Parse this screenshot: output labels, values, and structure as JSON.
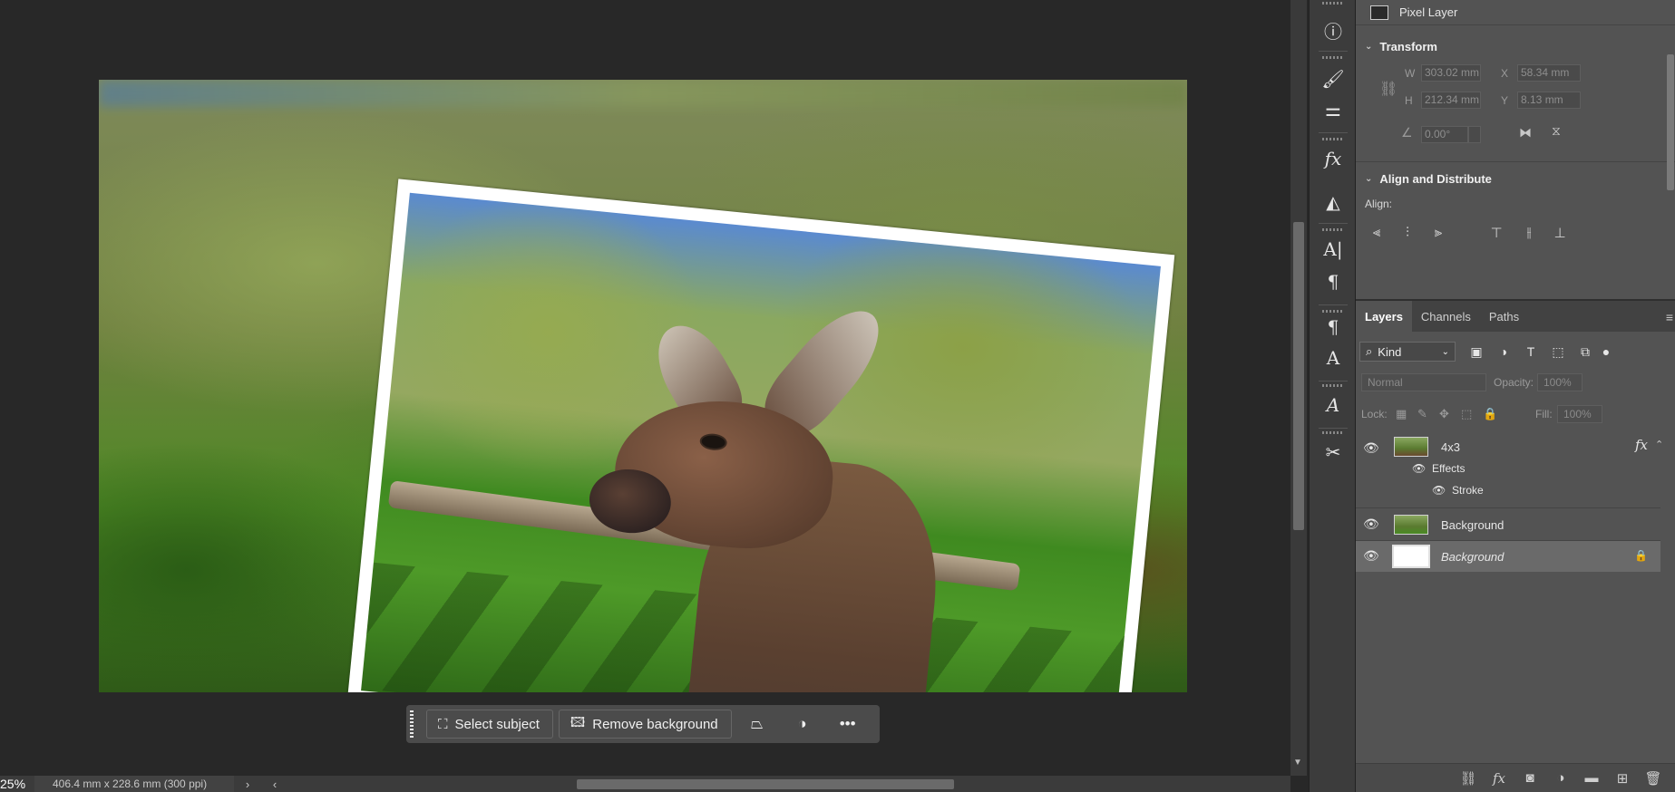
{
  "status": {
    "zoom": "25%",
    "doc_info": "406.4 mm x 228.6 mm (300 ppi)",
    "arrow": "›",
    "left_arrow": "‹"
  },
  "taskbar": {
    "select_subject": "Select subject",
    "remove_background": "Remove background"
  },
  "properties": {
    "layer_type": "Pixel Layer",
    "transform_title": "Transform",
    "w_label": "W",
    "w_value": "303.02 mm",
    "x_label": "X",
    "x_value": "58.34 mm",
    "h_label": "H",
    "h_value": "212.34 mm",
    "y_label": "Y",
    "y_value": "8.13 mm",
    "angle_value": "0.00°",
    "align_title": "Align and Distribute",
    "align_label": "Align:"
  },
  "layers_panel": {
    "tabs": [
      "Layers",
      "Channels",
      "Paths"
    ],
    "kind_label": "Kind",
    "blend_mode": "Normal",
    "opacity_label": "Opacity:",
    "opacity_value": "100%",
    "lock_label": "Lock:",
    "fill_label": "Fill:",
    "fill_value": "100%",
    "layers": [
      {
        "name": "4x3",
        "effects_label": "Effects",
        "effect": "Stroke"
      },
      {
        "name": "Background"
      },
      {
        "name": "Background"
      }
    ]
  },
  "colors": {
    "panel_bg": "#535353",
    "canvas_bg": "#282828",
    "selected_row": "#6a6a6a"
  }
}
